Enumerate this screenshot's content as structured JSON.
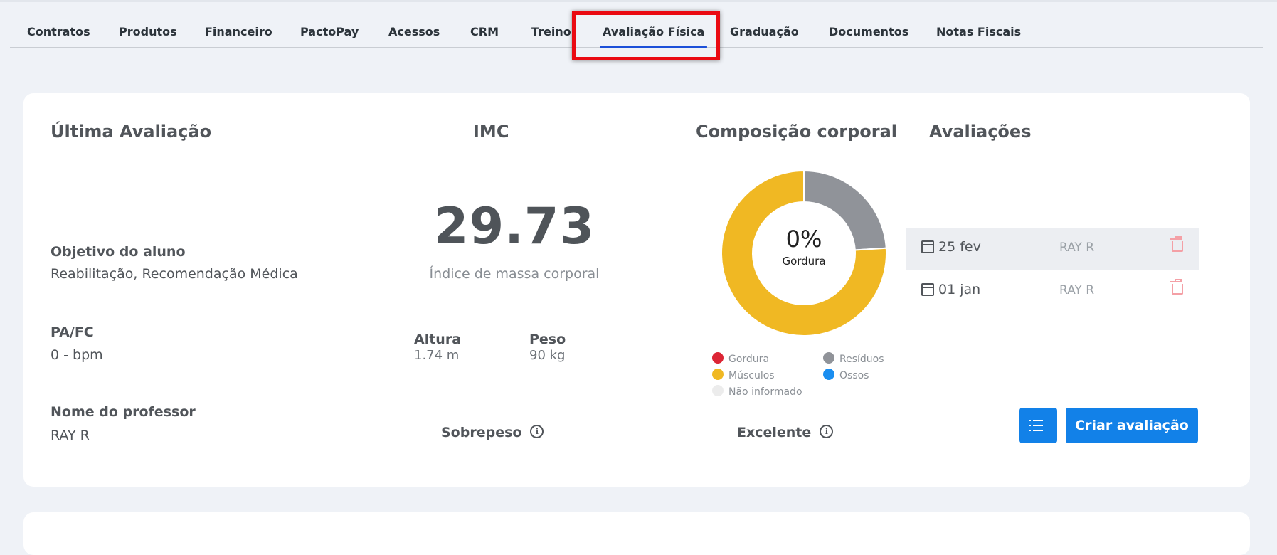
{
  "tabs": [
    {
      "label": "Contratos"
    },
    {
      "label": "Produtos"
    },
    {
      "label": "Financeiro"
    },
    {
      "label": "PactoPay"
    },
    {
      "label": "Acessos"
    },
    {
      "label": "CRM"
    },
    {
      "label": "Treino"
    },
    {
      "label": "Avaliação Física"
    },
    {
      "label": "Graduação"
    },
    {
      "label": "Documentos"
    },
    {
      "label": "Notas Fiscais"
    }
  ],
  "active_tab": "Avaliação Física",
  "colors": {
    "accent": "#1281e8",
    "tab_underline": "#1b4fd8",
    "highlight_box": "#ea0a12",
    "delete_icon": "#f4a0a6"
  },
  "last_evaluation": {
    "title": "Última Avaliação",
    "goal_label": "Objetivo do aluno",
    "goal_value": "Reabilitação, Recomendação Médica",
    "pafc_label": "PA/FC",
    "pafc_value": "0 - bpm",
    "teacher_label": "Nome do professor",
    "teacher_value": "RAY R"
  },
  "imc": {
    "title": "IMC",
    "value": "29.73",
    "subtitle": "Índice de massa corporal",
    "height_label": "Altura",
    "height_value": "1.74 m",
    "weight_label": "Peso",
    "weight_value": "90 kg",
    "status": "Sobrepeso"
  },
  "composition": {
    "title": "Composição corporal",
    "center_value": "0%",
    "center_label": "Gordura",
    "status": "Excelente",
    "legend": [
      {
        "label": "Gordura",
        "color": "#dc2535"
      },
      {
        "label": "Resíduos",
        "color": "#909399"
      },
      {
        "label": "Músculos",
        "color": "#f0b823"
      },
      {
        "label": "Ossos",
        "color": "#1a8ef0"
      },
      {
        "label": "Não informado",
        "color": "#ececec"
      }
    ]
  },
  "chart_data": {
    "type": "pie",
    "categories": [
      "Gordura",
      "Resíduos",
      "Músculos",
      "Ossos",
      "Não informado"
    ],
    "values": [
      0,
      24,
      76,
      0,
      0
    ],
    "colors": [
      "#dc2535",
      "#909399",
      "#f0b823",
      "#1a8ef0",
      "#ececec"
    ]
  },
  "evaluations": {
    "title": "Avaliações",
    "rows": [
      {
        "date": "25 fev",
        "professor": "RAY R",
        "selected": true
      },
      {
        "date": "01 jan",
        "professor": "RAY R",
        "selected": false
      }
    ],
    "create_label": "Criar avaliação"
  }
}
